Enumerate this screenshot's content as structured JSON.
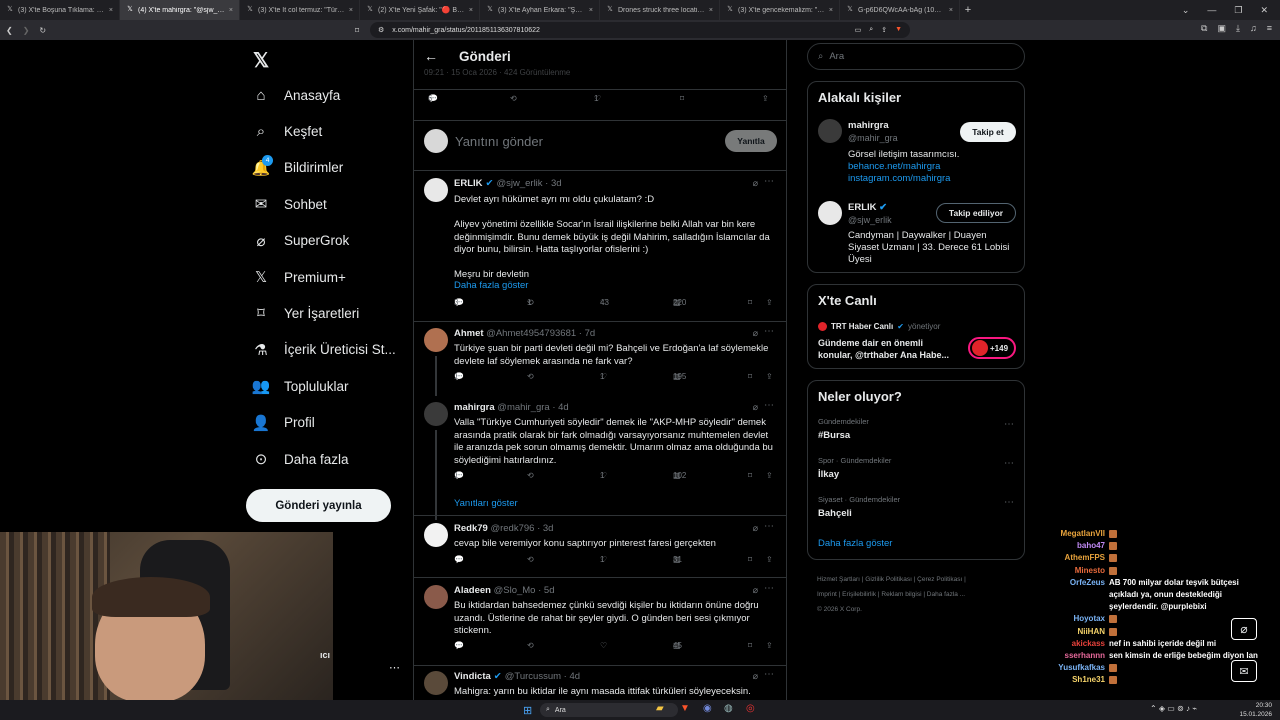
{
  "browser": {
    "tabs": [
      {
        "title": "(3) X'te Boşuna Tıklama: \"Türkiye, ex",
        "active": false
      },
      {
        "title": "(4) X'te mahirgra: \"@sjw_erlik Yo",
        "active": true
      },
      {
        "title": "(3) X'te İt col termuz: \"Türkiye, Irak",
        "active": false
      },
      {
        "title": "(2) X'te Yeni Şafak: \"🔴 Barzani'nin yı",
        "active": false
      },
      {
        "title": "(3) X'te Ayhan Erkara: \"Şaraa: Bomba",
        "active": false
      },
      {
        "title": "Drones struck three locations belong",
        "active": false
      },
      {
        "title": "(3) X'te gencekemalizm: \"Cizre'de yola",
        "active": false
      },
      {
        "title": "G-p6D6QWcAA-bAg (1080×1350)",
        "active": false
      }
    ],
    "new_tab": "+",
    "url": "x.com/mahir_gra/status/2011851136307810622"
  },
  "sidebar": {
    "items": [
      {
        "label": "Anasayfa",
        "icon": "home-icon"
      },
      {
        "label": "Keşfet",
        "icon": "search-icon"
      },
      {
        "label": "Bildirimler",
        "icon": "bell-icon",
        "badge": "4"
      },
      {
        "label": "Sohbet",
        "icon": "mail-icon"
      },
      {
        "label": "SuperGrok",
        "icon": "grok-icon"
      },
      {
        "label": "Premium+",
        "icon": "x-icon"
      },
      {
        "label": "Yer İşaretleri",
        "icon": "bookmark-icon"
      },
      {
        "label": "İçerik Üreticisi St...",
        "icon": "flask-icon"
      },
      {
        "label": "Topluluklar",
        "icon": "people-icon"
      },
      {
        "label": "Profil",
        "icon": "person-icon"
      },
      {
        "label": "Daha fazla",
        "icon": "more-circle-icon"
      }
    ],
    "post_button": "Gönderi yayınla",
    "account_partial": "ıcı"
  },
  "main": {
    "title": "Gönderi",
    "meta_partial": "09:21 · 15 Oca 2026 · 424 Görüntülenme",
    "stats": {
      "replies": "6",
      "likes": "1"
    },
    "reply_placeholder": "Yanıtını gönder",
    "reply_button": "Yanıtla",
    "tweets": [
      {
        "name": "ERLIK",
        "verified": true,
        "handle": "@sjw_erlik · 3d",
        "text": "Devlet ayrı hükümet ayrı mı oldu çukulatam? :D\n\nAliyev yönetimi özellikle Socar'ın İsrail ilişkilerine belki Allah var bin kere değinmişimdir. Bunu demek büyük iş değil Mahirim, salladığın İslamcılar da diyor bunu, bilirsin. Hatta taşlıyorlar ofislerini :)\n\nMeşru bir devletin",
        "more": "Daha fazla göster",
        "replies": "3",
        "retweets": "1",
        "likes": "43",
        "views": "220"
      },
      {
        "name": "Ahmet",
        "verified": false,
        "handle": "@Ahmet4954793681 · 7d",
        "text": "Türkiye şuan bir parti devleti değil mi? Bahçeli ve Erdoğan'a laf söylemekle devlete laf söylemek arasında ne fark var?",
        "replies": "1",
        "retweets": "",
        "likes": "1",
        "views": "195"
      },
      {
        "name": "mahirgra",
        "verified": false,
        "handle": "@mahir_gra · 4d",
        "text": "Valla \"Türkiye Cumhuriyeti söyledir\" demek ile \"AKP-MHP söyledir\" demek arasında pratik olarak bir fark olmadığı varsayıyorsanız muhtemelen devlet ile aranızda pek sorun olmamış demektir. Umarım olmaz ama olduğunda bu söylediğimi hatırlardınız.",
        "replies": "1",
        "retweets": "",
        "likes": "1",
        "views": "102"
      },
      {
        "name": "Redk79",
        "verified": false,
        "handle": "@redk796 · 3d",
        "text": "cevap bile veremiyor konu saptırıyor pinterest  faresi gerçekten",
        "replies": "",
        "retweets": "",
        "likes": "1",
        "views": "31"
      },
      {
        "name": "Aladeen",
        "verified": false,
        "handle": "@Slo_Mo · 5d",
        "text": "Bu iktidardan bahsedemez çünkü sevdiği kişiler bu iktidarın önüne doğru uzandı. Üstlerine de rahat bir şeyler giydi. O günden beri sesi çıkmıyor stickenn.",
        "replies": "",
        "retweets": "",
        "likes": "",
        "views": "45"
      },
      {
        "name": "Vindicta",
        "verified": true,
        "handle": "@Turcussum · 4d",
        "text": "Mahigra: yarın bu iktidar ile aynı masada ittifak türküleri söyleyeceksin.",
        "replies": "",
        "retweets": "",
        "likes": "",
        "views": ""
      }
    ],
    "show_replies": "Yanıtları göster"
  },
  "right": {
    "search_placeholder": "Ara",
    "related": {
      "title": "Alakalı kişiler",
      "people": [
        {
          "name": "mahirgra",
          "handle": "@mahir_gra",
          "bio": "Görsel iletişim tasarımcısı.",
          "links": [
            "behance.net/mahirgra",
            "instagram.com/mahirgra"
          ],
          "button": "Takip et"
        },
        {
          "name": "ERLIK",
          "handle": "@sjw_erlik",
          "bio": "Candyman | Daywalker | Duayen Siyaset Uzmanı | 33. Derece 61 Lobisi Üyesi",
          "button": "Takip ediliyor"
        }
      ]
    },
    "live": {
      "title": "X'te Canlı",
      "host": "TRT Haber Canlı",
      "role": "yönetiyor",
      "desc": "Gündeme dair en önemli konular, @trthaber Ana Habe...",
      "count": "+149"
    },
    "trends": {
      "title": "Neler oluyor?",
      "items": [
        {
          "meta": "Gündemdekiler",
          "name": "#Bursa"
        },
        {
          "meta": "Spor · Gündemdekiler",
          "name": "İlkay"
        },
        {
          "meta": "Siyaset · Gündemdekiler",
          "name": "Bahçeli"
        }
      ],
      "more": "Daha fazla göster"
    },
    "footer": {
      "line1": "Hizmet Şartları  |  Gizlilik Politikası  |  Çerez Politikası  |",
      "line2": "Imprint  |  Erişilebilirlik  |  Reklam bilgisi  |  Daha fazla ...",
      "line3": "© 2026 X Corp."
    }
  },
  "chat": [
    {
      "user": "MegatlanVII",
      "color": "#e8a33c",
      "msg": ""
    },
    {
      "user": "baho47",
      "color": "#c08af5",
      "msg": ""
    },
    {
      "user": "AthemFPS",
      "color": "#e8a33c",
      "msg": ""
    },
    {
      "user": "Minesto",
      "color": "#e86a3c",
      "msg": ""
    },
    {
      "user": "OrfeZeus",
      "color": "#7ab3f5",
      "msg": "AB 700 milyar dolar teşvik bütçesi açıkladı ya, onun desteklediği şeylerdendir. @purplebixi"
    },
    {
      "user": "Hoyotax",
      "color": "#7ab3f5",
      "msg": ""
    },
    {
      "user": "NiiHAN",
      "color": "#f5d36a",
      "msg": ""
    },
    {
      "user": "akickass",
      "color": "#e8423c",
      "msg": "nef in sahibi içeride değil mi"
    },
    {
      "user": "sserhannn",
      "color": "#e86a9c",
      "msg": "sen kimsin de erliğe bebeğim diyon lan"
    },
    {
      "user": "Yusufkafkas",
      "color": "#7ab3f5",
      "msg": ""
    },
    {
      "user": "Sh1ne31",
      "color": "#f5d36a",
      "msg": ""
    }
  ],
  "taskbar": {
    "search": "Ara",
    "time": "20:30",
    "date": "15.01.2026"
  }
}
